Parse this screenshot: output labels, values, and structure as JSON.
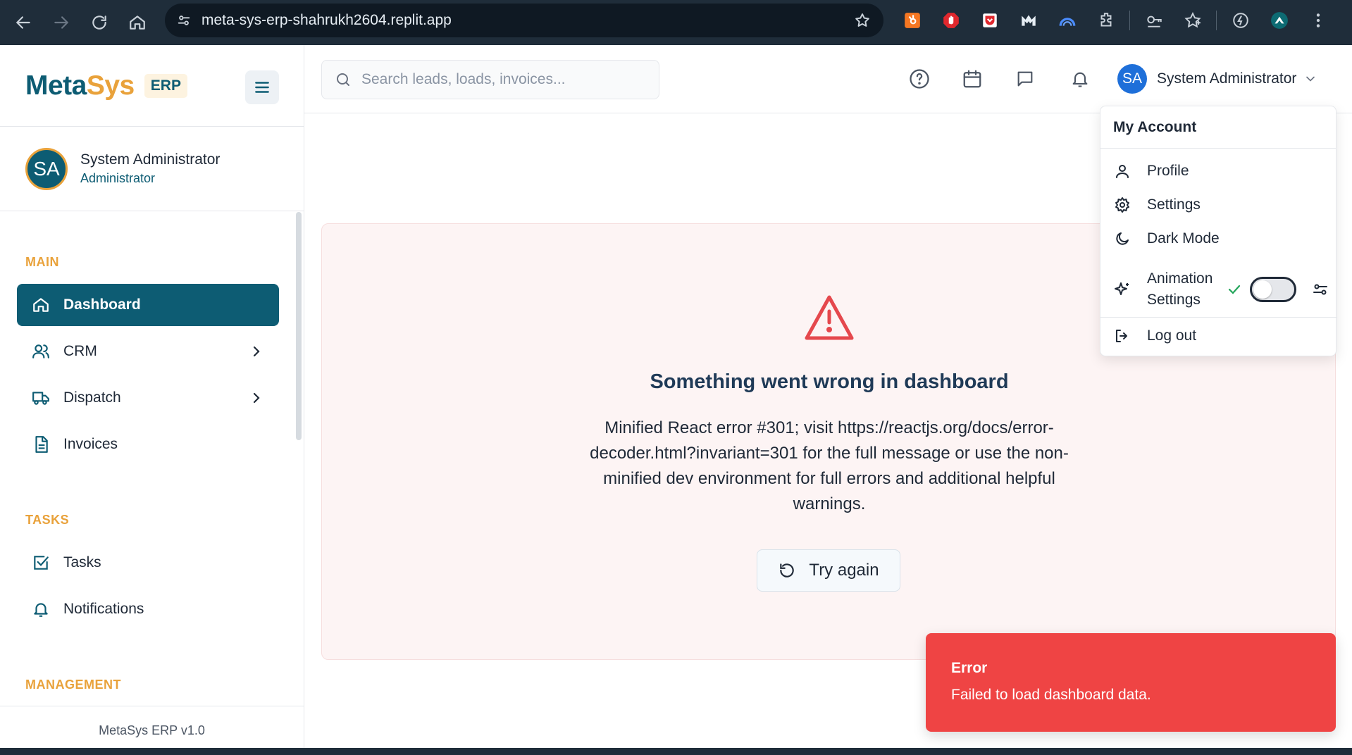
{
  "browser": {
    "url": "meta-sys-erp-shahrukh2604.replit.app",
    "extensions": [
      "hubspot-icon",
      "adblock-icon",
      "pocket-icon",
      "m-logo-icon",
      "arc-icon",
      "puzzle-icon",
      "password-key-icon",
      "favorites-star-icon",
      "sync-icon",
      "profile-avatar-icon"
    ]
  },
  "sidebar": {
    "brand_meta": "Meta",
    "brand_sys": "Sys",
    "brand_badge": "ERP",
    "user": {
      "initials": "SA",
      "name": "System Administrator",
      "role": "Administrator"
    },
    "sections": {
      "main": "MAIN",
      "tasks": "TASKS",
      "management": "MANAGEMENT"
    },
    "items": [
      {
        "label": "Dashboard",
        "icon": "home-icon",
        "active": true
      },
      {
        "label": "CRM",
        "icon": "users-icon",
        "has_children": true
      },
      {
        "label": "Dispatch",
        "icon": "truck-icon",
        "has_children": true
      },
      {
        "label": "Invoices",
        "icon": "file-text-icon"
      },
      {
        "label": "Tasks",
        "icon": "check-square-icon"
      },
      {
        "label": "Notifications",
        "icon": "bell-icon"
      }
    ],
    "footer": "MetaSys ERP v1.0"
  },
  "header": {
    "search_placeholder": "Search leads, loads, invoices...",
    "icons": [
      "help-icon",
      "calendar-icon",
      "message-icon",
      "bell-icon"
    ],
    "user_initials": "SA",
    "user_name": "System Administrator"
  },
  "error": {
    "title": "Something went wrong in dashboard",
    "message": "Minified React error #301; visit https://reactjs.org/docs/error-decoder.html?invariant=301 for the full message or use the non-minified dev environment for full errors and additional helpful warnings.",
    "button": "Try again"
  },
  "account_menu": {
    "header": "My Account",
    "profile": "Profile",
    "settings": "Settings",
    "dark_mode": "Dark Mode",
    "animation_1": "Animation",
    "animation_2": "Settings",
    "animation_enabled": false,
    "logout": "Log out"
  },
  "toast": {
    "title": "Error",
    "description": "Failed to load dashboard data.",
    "color": "#ef4444"
  },
  "colors": {
    "primary": "#0d5c73",
    "accent": "#e9a23b",
    "error": "#e5484d"
  }
}
